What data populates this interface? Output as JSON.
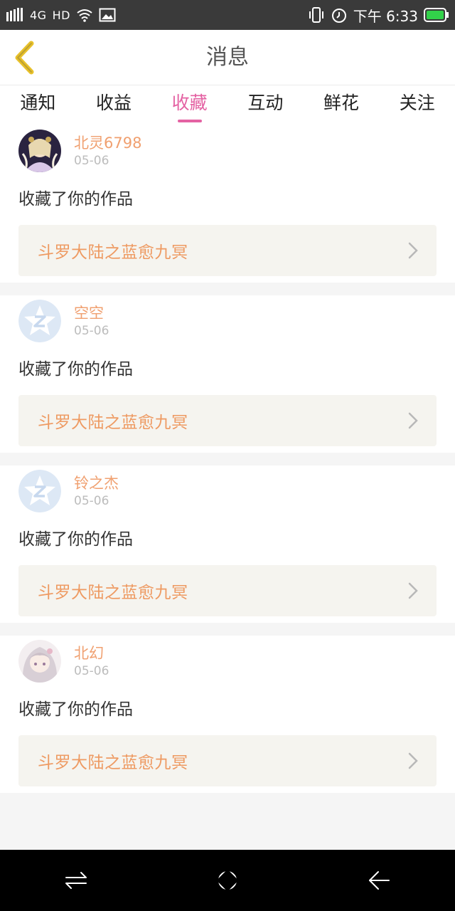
{
  "status_bar": {
    "network": "4G",
    "hd": "HD",
    "time": "下午 6:33"
  },
  "header": {
    "title": "消息"
  },
  "tabs": [
    {
      "label": "通知"
    },
    {
      "label": "收益"
    },
    {
      "label": "收藏",
      "active": true
    },
    {
      "label": "互动"
    },
    {
      "label": "鲜花"
    },
    {
      "label": "关注"
    }
  ],
  "messages": [
    {
      "username": "北灵6798",
      "date": "05-06",
      "action": "收藏了你的作品",
      "work_title": "斗罗大陆之蓝愈九冥",
      "avatar": "anime-avatar-dark"
    },
    {
      "username": "空空",
      "date": "05-06",
      "action": "收藏了你的作品",
      "work_title": "斗罗大陆之蓝愈九冥",
      "avatar": "default-avatar"
    },
    {
      "username": "铃之杰",
      "date": "05-06",
      "action": "收藏了你的作品",
      "work_title": "斗罗大陆之蓝愈九冥",
      "avatar": "default-avatar"
    },
    {
      "username": "北幻",
      "date": "05-06",
      "action": "收藏了你的作品",
      "work_title": "斗罗大陆之蓝愈九冥",
      "avatar": "anime-avatar-light"
    }
  ],
  "colors": {
    "accent": "#e462a3",
    "username": "#f0a070",
    "work_title": "#ee9a62",
    "link_bg": "#f5f4ef",
    "back_icon": "#e8c12a"
  }
}
